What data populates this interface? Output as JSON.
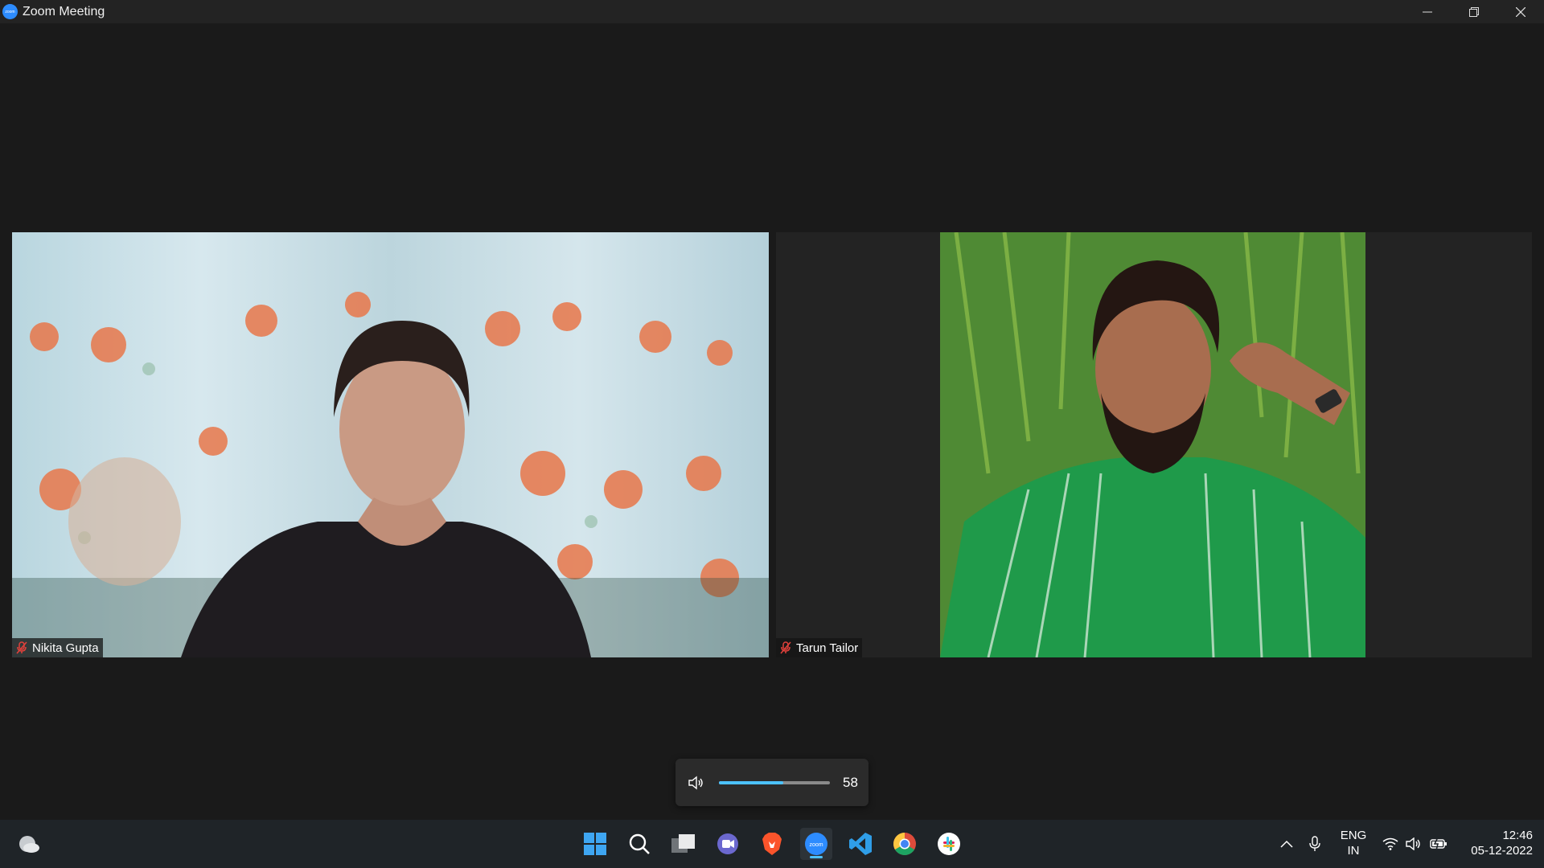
{
  "window": {
    "title": "Zoom Meeting",
    "logo_text": "zoom"
  },
  "participants": [
    {
      "name": "Nikita Gupta",
      "muted": true
    },
    {
      "name": "Tarun Tailor",
      "muted": true
    }
  ],
  "volume": {
    "value": "58",
    "level": 0.58
  },
  "taskbar": {
    "apps": [
      "weather",
      "start",
      "search",
      "task-view",
      "teams-chat",
      "brave",
      "zoom",
      "vscode",
      "chrome",
      "slack"
    ],
    "active_app": "zoom"
  },
  "tray": {
    "lang_line1": "ENG",
    "lang_line2": "IN",
    "time": "12:46",
    "date": "05-12-2022"
  },
  "colors": {
    "accent": "#4cc2ff",
    "zoom_blue": "#2d8cff",
    "mute_red": "#e0413b"
  }
}
